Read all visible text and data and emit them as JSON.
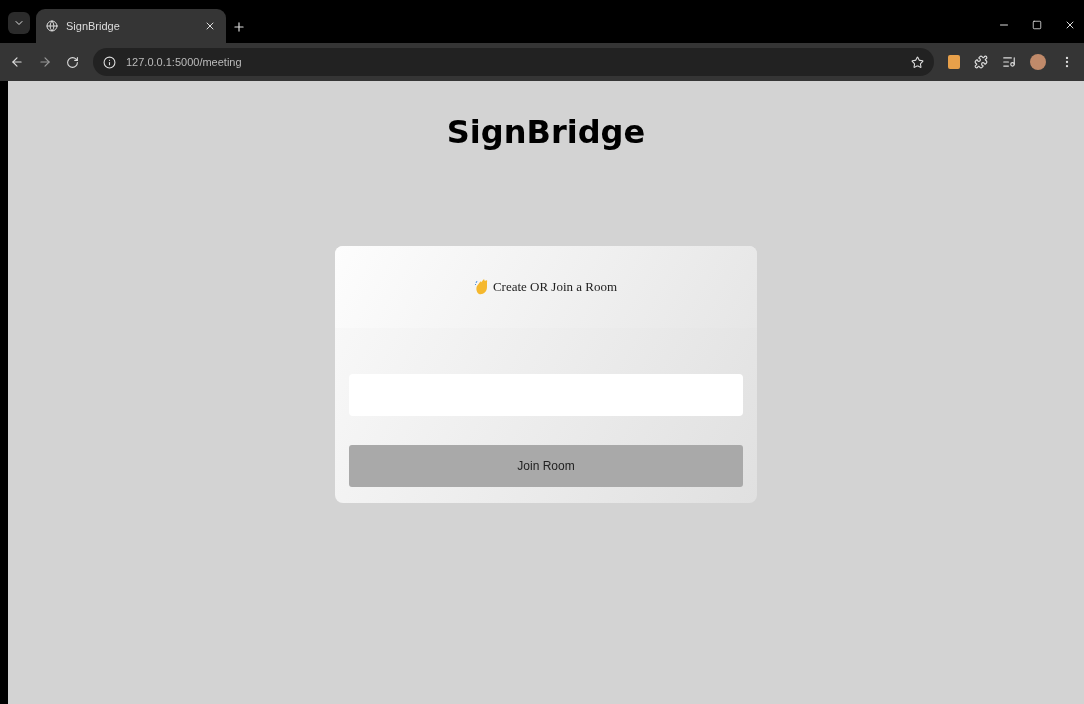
{
  "browser": {
    "tab": {
      "title": "SignBridge",
      "selected": true
    },
    "url": "127.0.0.1:5000/meeting"
  },
  "page": {
    "title": "SignBridge",
    "card": {
      "heading": "Create OR Join a Room",
      "button": "Join Room"
    }
  }
}
